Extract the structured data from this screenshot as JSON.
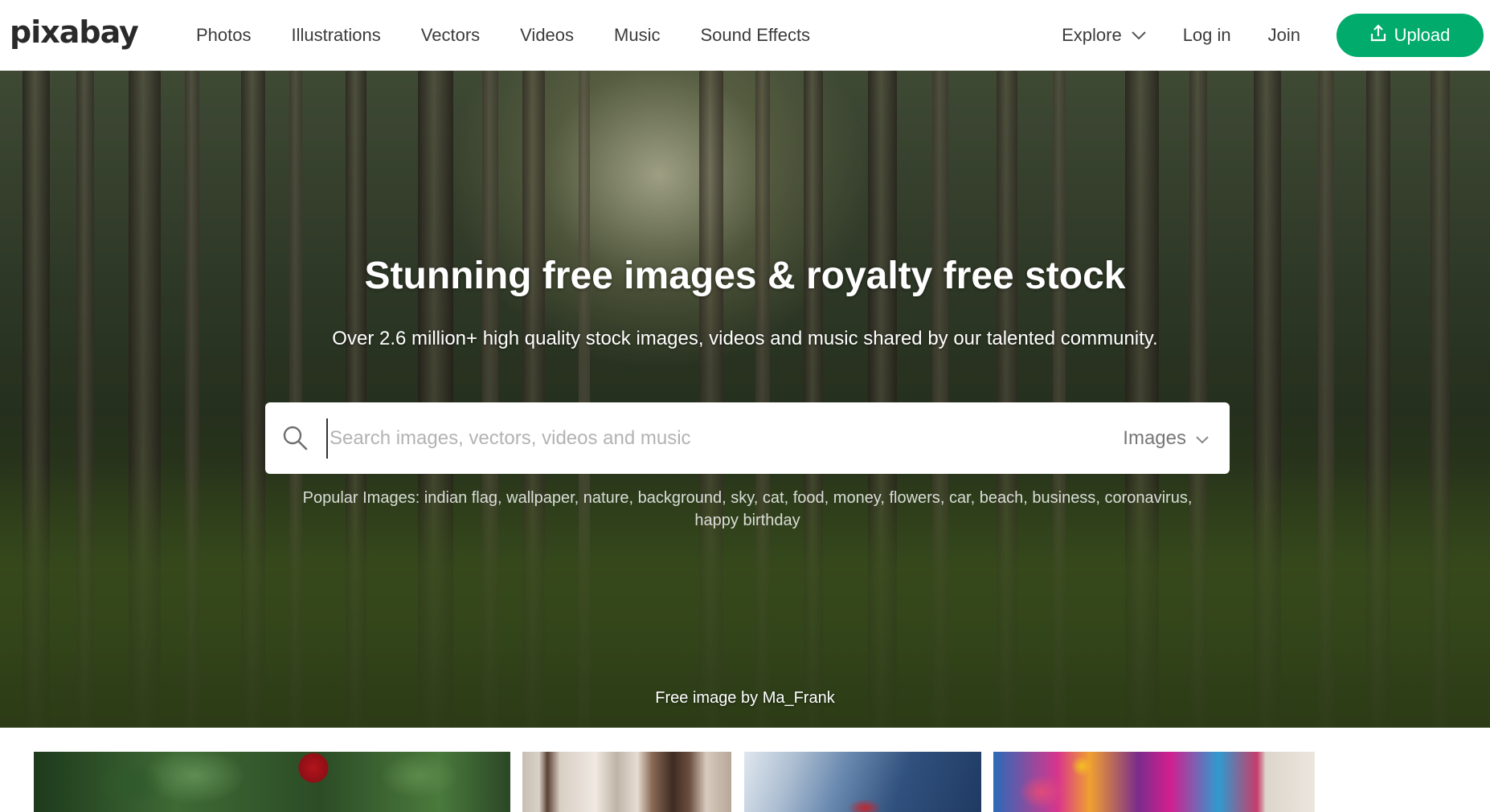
{
  "brand": {
    "logo_text": "pixabay"
  },
  "nav": {
    "items": [
      {
        "label": "Photos"
      },
      {
        "label": "Illustrations"
      },
      {
        "label": "Vectors"
      },
      {
        "label": "Videos"
      },
      {
        "label": "Music"
      },
      {
        "label": "Sound Effects"
      }
    ],
    "explore_label": "Explore",
    "login_label": "Log in",
    "join_label": "Join",
    "upload_label": "Upload"
  },
  "hero": {
    "title": "Stunning free images & royalty free stock",
    "subtitle": "Over 2.6 million+ high quality stock images, videos and music shared by our talented community.",
    "search": {
      "placeholder": "Search images, vectors, videos and music",
      "value": "",
      "type_selected": "Images"
    },
    "popular": {
      "label": "Popular Images:",
      "tags": [
        "indian flag",
        "wallpaper",
        "nature",
        "background",
        "sky",
        "cat",
        "food",
        "money",
        "flowers",
        "car",
        "beach",
        "business",
        "coronavirus",
        "happy birthday"
      ]
    },
    "credit": {
      "prefix": "Free image by",
      "author": "Ma_Frank"
    }
  },
  "colors": {
    "brand_green": "#00ab6b",
    "text_dark": "#3b3b3b"
  },
  "icons": {
    "search": "search-icon",
    "upload": "upload-icon",
    "chevron": "chevron-down-icon"
  }
}
